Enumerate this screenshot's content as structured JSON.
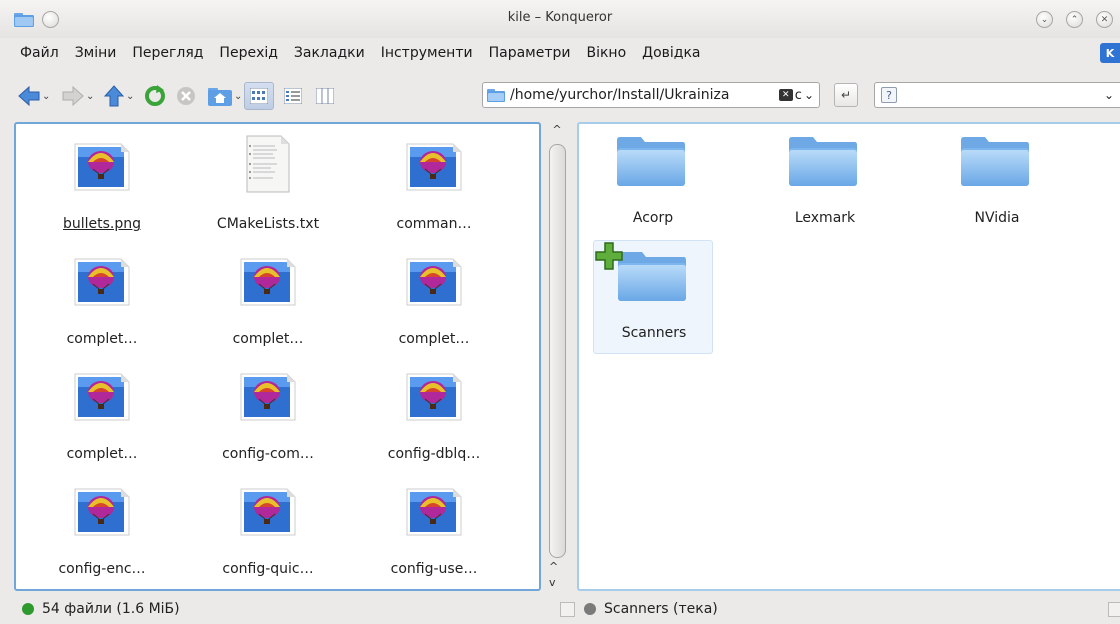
{
  "window": {
    "title": "kile – Konqueror"
  },
  "menubar": {
    "items": [
      {
        "label": "Файл"
      },
      {
        "label": "Зміни"
      },
      {
        "label": "Перегляд"
      },
      {
        "label": "Перехід"
      },
      {
        "label": "Закладки"
      },
      {
        "label": "Інструменти"
      },
      {
        "label": "Параметри"
      },
      {
        "label": "Вікно"
      },
      {
        "label": "Довідка"
      }
    ]
  },
  "toolbar": {
    "buttons": [
      {
        "icon": "back-arrow-icon"
      },
      {
        "icon": "forward-arrow-icon"
      },
      {
        "icon": "up-arrow-icon"
      },
      {
        "icon": "reload-icon"
      },
      {
        "icon": "stop-icon"
      },
      {
        "icon": "home-icon"
      },
      {
        "icon": "icon-view-icon"
      },
      {
        "icon": "details-view-icon"
      },
      {
        "icon": "column-view-icon"
      }
    ],
    "location": "/home/yurchor/Install/Ukrainiza",
    "search_placeholder": ""
  },
  "left_pane": {
    "files": [
      {
        "name": "bullets.png",
        "type": "image"
      },
      {
        "name": "CMakeLists.txt",
        "type": "text"
      },
      {
        "name": "comman…",
        "type": "image"
      },
      {
        "name": "complet…",
        "type": "image"
      },
      {
        "name": "complet…",
        "type": "image"
      },
      {
        "name": "complet…",
        "type": "image"
      },
      {
        "name": "complet…",
        "type": "image"
      },
      {
        "name": "config-com…",
        "type": "image"
      },
      {
        "name": "config-dblq…",
        "type": "image"
      },
      {
        "name": "config-enc…",
        "type": "image"
      },
      {
        "name": "config-quic…",
        "type": "image"
      },
      {
        "name": "config-use…",
        "type": "image"
      }
    ]
  },
  "right_pane": {
    "folders": [
      {
        "name": "Acorp"
      },
      {
        "name": "Lexmark"
      },
      {
        "name": "NVidia"
      },
      {
        "name": "Scanners"
      }
    ]
  },
  "status": {
    "left": "54 файли (1.6 МіБ)",
    "right": "Scanners (тека)",
    "led_active": "#2e9a2e",
    "led_inactive": "#7a7a7a"
  },
  "colors": {
    "active_border": "#71a6d8",
    "folder_blue": "#5d9ee4"
  }
}
